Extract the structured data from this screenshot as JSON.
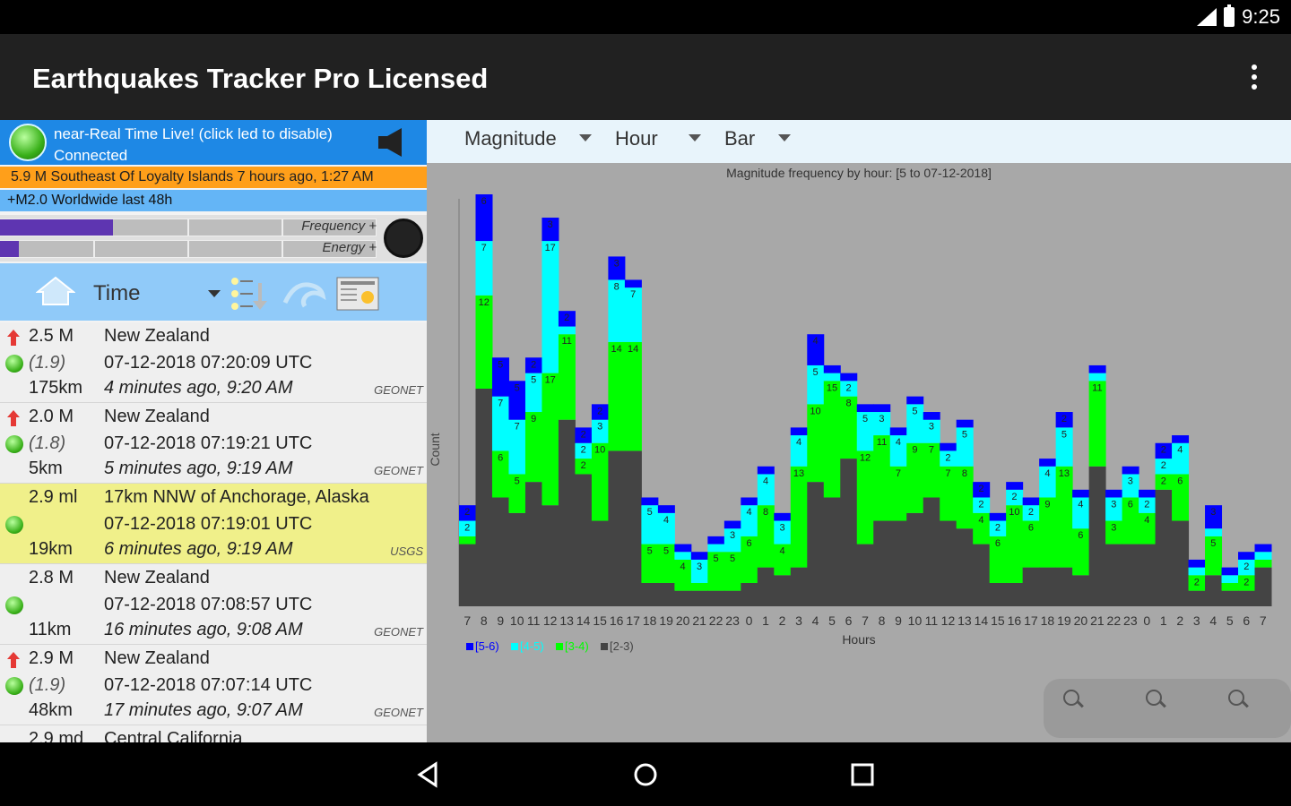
{
  "status_bar": {
    "time": "9:25",
    "signal": "4G"
  },
  "app": {
    "title": "Earthquakes Tracker Pro Licensed",
    "menu_icon": "overflow-menu-icon"
  },
  "live": {
    "line1": "near-Real Time Live! (click led to disable)",
    "line2": "Connected",
    "ticker": "5.9 M Southeast Of Loyalty Islands 7 hours ago, 1:27 AM",
    "filter": "+M2.0 Worldwide last 48h"
  },
  "meters": {
    "frequency_label": "Frequency +",
    "energy_label": "Energy +",
    "frequency_level": 0.3,
    "energy_level": 0.05
  },
  "toolbar": {
    "sort_label": "Time"
  },
  "quakes": [
    {
      "mag": "2.5 M",
      "loc": "New Zealand",
      "neighbor": "(1.9)",
      "utc": "07-12-2018 07:20:09 UTC",
      "dist": "175km",
      "ago": "4 minutes ago, 9:20 AM",
      "src": "GEONET",
      "arrow": true,
      "highlight": false
    },
    {
      "mag": "2.0 M",
      "loc": "New Zealand",
      "neighbor": "(1.8)",
      "utc": "07-12-2018 07:19:21 UTC",
      "dist": "5km",
      "ago": "5 minutes ago, 9:19 AM",
      "src": "GEONET",
      "arrow": true,
      "highlight": false
    },
    {
      "mag": "2.9 ml",
      "loc": "17km NNW of Anchorage, Alaska",
      "neighbor": "",
      "utc": "07-12-2018 07:19:01 UTC",
      "dist": "19km",
      "ago": "6 minutes ago, 9:19 AM",
      "src": "USGS",
      "arrow": false,
      "highlight": true
    },
    {
      "mag": "2.8 M",
      "loc": "New Zealand",
      "neighbor": "",
      "utc": "07-12-2018 07:08:57 UTC",
      "dist": "11km",
      "ago": "16 minutes ago, 9:08 AM",
      "src": "GEONET",
      "arrow": false,
      "highlight": false
    },
    {
      "mag": "2.9 M",
      "loc": "New Zealand",
      "neighbor": "(1.9)",
      "utc": "07-12-2018 07:07:14 UTC",
      "dist": "48km",
      "ago": "17 minutes ago, 9:07 AM",
      "src": "GEONET",
      "arrow": true,
      "highlight": false
    },
    {
      "mag": "2.9 md",
      "loc": "Central California",
      "neighbor": "",
      "utc": "",
      "dist": "",
      "ago": "",
      "src": "",
      "arrow": false,
      "highlight": false
    }
  ],
  "chart_controls": {
    "metric": "Magnitude",
    "group": "Hour",
    "type": "Bar"
  },
  "chart_data": {
    "type": "bar",
    "stacked": true,
    "title": "Magnitude frequency by hour: [5 to 07-12-2018]",
    "xlabel": "Hours",
    "ylabel": "Count",
    "categories": [
      "7",
      "8",
      "9",
      "10",
      "11",
      "12",
      "13",
      "14",
      "15",
      "16",
      "17",
      "18",
      "19",
      "20",
      "21",
      "22",
      "23",
      "0",
      "1",
      "2",
      "3",
      "4",
      "5",
      "6",
      "7",
      "8",
      "9",
      "10",
      "11",
      "12",
      "13",
      "14",
      "15",
      "16",
      "17",
      "18",
      "19",
      "20",
      "21",
      "22",
      "23",
      "0",
      "1",
      "2",
      "3",
      "4",
      "5",
      "6",
      "7"
    ],
    "series": [
      {
        "name": "[2-3)",
        "color": "#444444",
        "values": [
          8,
          28,
          14,
          12,
          16,
          13,
          24,
          17,
          11,
          20,
          20,
          3,
          3,
          2,
          2,
          2,
          2,
          3,
          5,
          4,
          5,
          16,
          14,
          19,
          8,
          11,
          11,
          12,
          14,
          11,
          10,
          8,
          3,
          3,
          5,
          5,
          5,
          4,
          18,
          8,
          8,
          8,
          15,
          11,
          2,
          4,
          2,
          2,
          5
        ]
      },
      {
        "name": "[3-4)",
        "color": "#00ff00",
        "values": [
          1,
          12,
          6,
          5,
          9,
          17,
          11,
          2,
          10,
          14,
          14,
          5,
          5,
          4,
          1,
          5,
          5,
          6,
          8,
          4,
          13,
          10,
          15,
          8,
          12,
          11,
          7,
          9,
          7,
          7,
          8,
          4,
          6,
          10,
          6,
          9,
          13,
          6,
          11,
          3,
          6,
          4,
          2,
          6,
          2,
          5,
          1,
          2,
          1
        ]
      },
      {
        "name": "[4-5)",
        "color": "#00ffff",
        "values": [
          2,
          7,
          7,
          7,
          5,
          17,
          1,
          2,
          3,
          8,
          7,
          5,
          4,
          1,
          3,
          1,
          3,
          4,
          4,
          3,
          4,
          5,
          1,
          2,
          5,
          3,
          4,
          5,
          3,
          2,
          5,
          2,
          2,
          2,
          2,
          4,
          5,
          4,
          1,
          3,
          3,
          2,
          2,
          4,
          1,
          1,
          1,
          2,
          1
        ]
      },
      {
        "name": "[5-6)",
        "color": "#0000ff",
        "values": [
          2,
          6,
          5,
          5,
          2,
          3,
          2,
          2,
          2,
          3,
          1,
          1,
          1,
          1,
          1,
          1,
          1,
          1,
          1,
          1,
          1,
          4,
          1,
          1,
          1,
          1,
          1,
          1,
          1,
          1,
          1,
          2,
          1,
          1,
          1,
          1,
          2,
          1,
          1,
          1,
          1,
          1,
          2,
          1,
          1,
          3,
          1,
          1,
          1
        ]
      }
    ],
    "ylim": [
      0,
      6
    ]
  }
}
